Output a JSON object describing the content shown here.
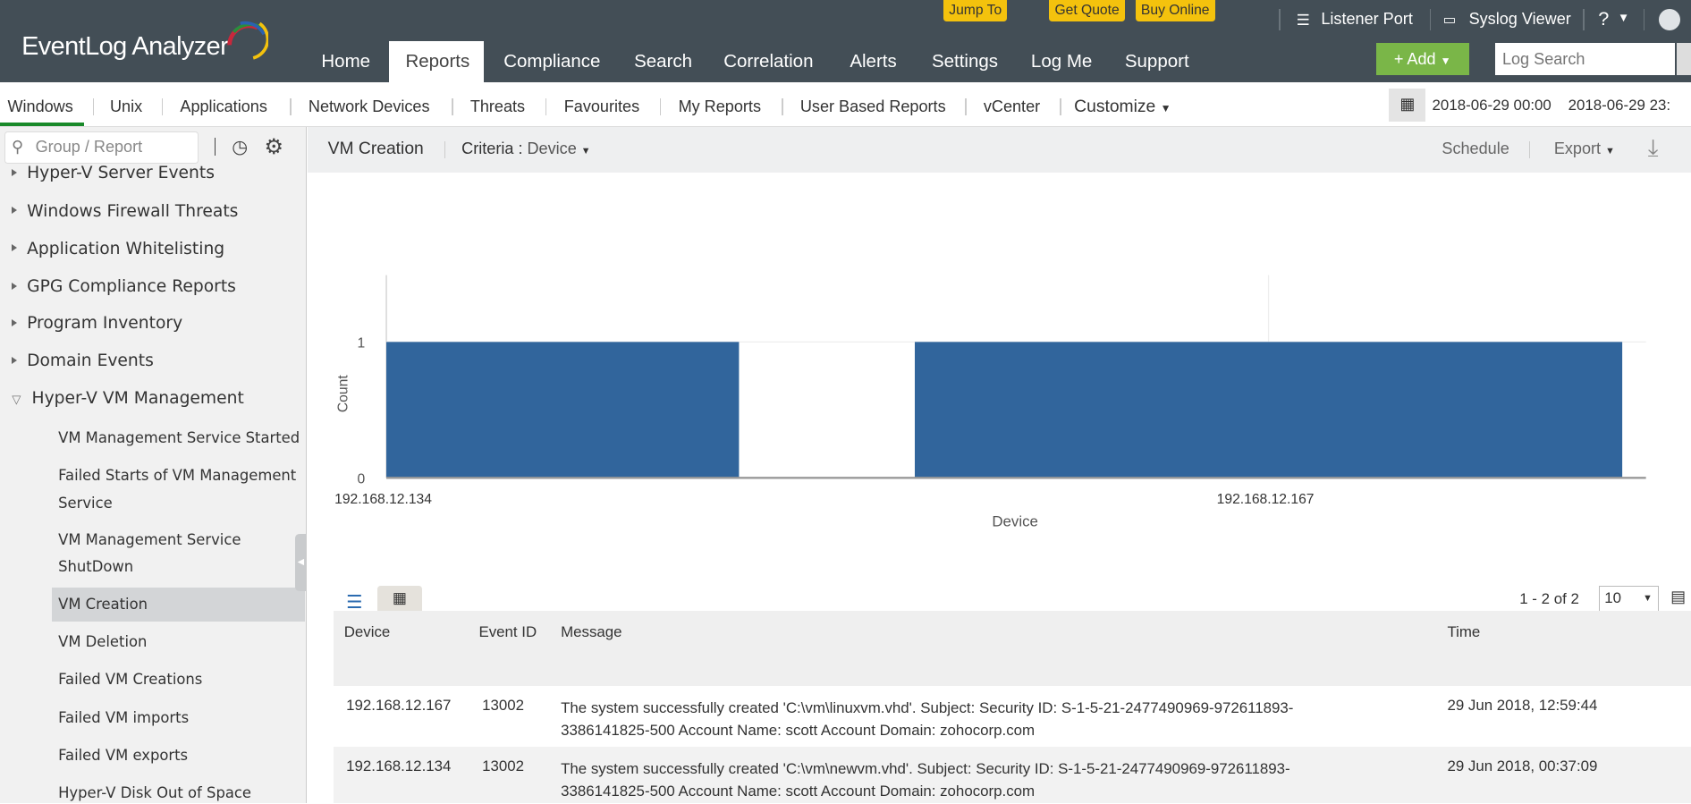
{
  "app": {
    "logo": "EventLog Analyzer"
  },
  "promo": {
    "jump_to": "Jump To",
    "get_quote": "Get Quote",
    "buy_online": "Buy Online"
  },
  "nav": [
    "Home",
    "Reports",
    "Compliance",
    "Search",
    "Correlation",
    "Alerts",
    "Settings",
    "Log Me",
    "Support"
  ],
  "toplinks": {
    "listener_port": "Listener Port",
    "syslog_viewer": "Syslog Viewer",
    "help": "?"
  },
  "add_label": "+ Add",
  "log_search_placeholder": "Log Search",
  "subnav": [
    "Windows",
    "Unix",
    "Applications",
    "Network Devices",
    "Threats",
    "Favourites",
    "My Reports",
    "User Based Reports",
    "vCenter",
    "Customize"
  ],
  "date_range": {
    "start": "2018-06-29 00:00",
    "end": "2018-06-29 23:"
  },
  "sidebar": {
    "search_placeholder": "Group / Report",
    "groups": [
      "Hyper-V Server Events",
      "Windows Firewall Threats",
      "Application Whitelisting",
      "GPG Compliance Reports",
      "Program Inventory",
      "Domain Events",
      "Hyper-V VM Management"
    ],
    "children": [
      [
        "VM Management Service Started"
      ],
      [
        "Failed Starts of VM Management",
        "Service"
      ],
      [
        "VM Management Service",
        "ShutDown"
      ],
      [
        "VM Creation"
      ],
      [
        "VM Deletion"
      ],
      [
        "Failed VM Creations"
      ],
      [
        "Failed VM imports"
      ],
      [
        "Failed VM exports"
      ],
      [
        "Hyper-V Disk Out of Space"
      ]
    ]
  },
  "report": {
    "title": "VM Creation",
    "criteria_label": "Criteria :",
    "criteria_value": "Device",
    "schedule": "Schedule",
    "export": "Export"
  },
  "chart_data": {
    "type": "bar",
    "categories": [
      "192.168.12.134",
      "192.168.12.167"
    ],
    "values": [
      1,
      1
    ],
    "xlabel": "Device",
    "ylabel": "Count",
    "ylim": [
      0,
      1
    ],
    "yticks": [
      "0",
      "1"
    ],
    "color": "#31659c"
  },
  "table": {
    "pagination": "1 - 2 of 2",
    "page_size": "10",
    "columns": [
      "Device",
      "Event ID",
      "Message",
      "Time"
    ],
    "rows": [
      {
        "device": "192.168.12.167",
        "event_id": "13002",
        "message": [
          "The system successfully created 'C:\\vm\\linuxvm.vhd'. Subject: Security ID: S-1-5-21-2477490969-972611893-",
          "3386141825-500 Account Name: scott Account Domain: zohocorp.com"
        ],
        "time": "29 Jun 2018, 12:59:44"
      },
      {
        "device": "192.168.12.134",
        "event_id": "13002",
        "message": [
          "The system successfully created 'C:\\vm\\newvm.vhd'. Subject: Security ID: S-1-5-21-2477490969-972611893-",
          "3386141825-500 Account Name: scott Account Domain: zohocorp.com"
        ],
        "time": "29 Jun 2018, 00:37:09"
      }
    ]
  }
}
